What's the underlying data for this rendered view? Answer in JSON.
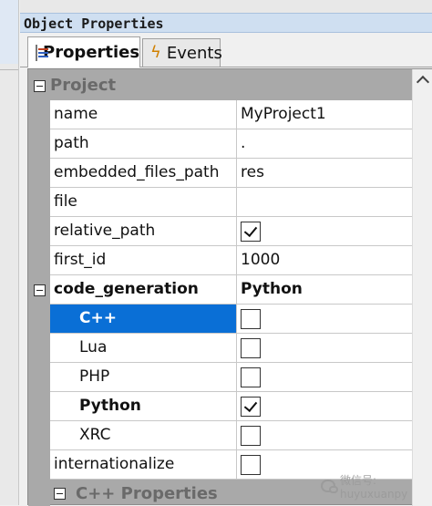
{
  "window": {
    "title": "Object Properties"
  },
  "tabs": [
    {
      "label": "Properties",
      "icon": "properties-icon",
      "active": true
    },
    {
      "label": "Events",
      "icon": "lightning-icon",
      "active": false
    }
  ],
  "sections": {
    "project": "Project",
    "cpp_properties": "C++ Properties"
  },
  "properties": [
    {
      "name": "name",
      "value": "MyProject1",
      "type": "text"
    },
    {
      "name": "path",
      "value": ".",
      "type": "text"
    },
    {
      "name": "embedded_files_path",
      "value": "res",
      "type": "text"
    },
    {
      "name": "file",
      "value": "",
      "type": "text"
    },
    {
      "name": "relative_path",
      "value": "",
      "type": "checkbox",
      "checked": true
    },
    {
      "name": "first_id",
      "value": "1000",
      "type": "text"
    },
    {
      "name": "code_generation",
      "value": "Python",
      "type": "group"
    },
    {
      "name": "C++",
      "type": "checkbox",
      "checked": false,
      "child": true,
      "selected": true
    },
    {
      "name": "Lua",
      "type": "checkbox",
      "checked": false,
      "child": true
    },
    {
      "name": "PHP",
      "type": "checkbox",
      "checked": false,
      "child": true
    },
    {
      "name": "Python",
      "type": "checkbox",
      "checked": true,
      "child": true,
      "bold": true
    },
    {
      "name": "XRC",
      "type": "checkbox",
      "checked": false,
      "child": true
    },
    {
      "name": "internationalize",
      "type": "checkbox",
      "checked": false
    }
  ],
  "watermark": {
    "text": "微信号: huyuxuanpy"
  },
  "colors": {
    "selection": "#0a6fd6",
    "titlebar": "#cfdff1",
    "grid_background": "#a9a9a9"
  }
}
